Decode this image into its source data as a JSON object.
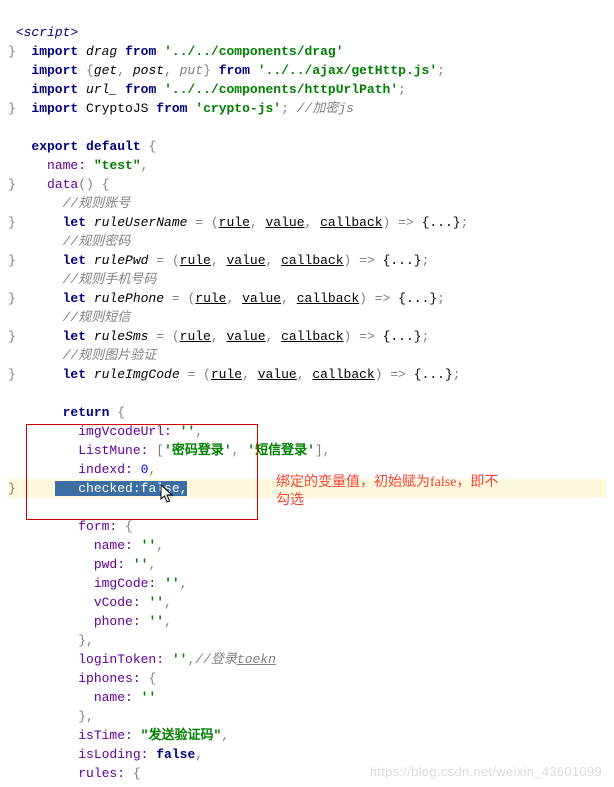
{
  "code": {
    "script_open": "<script>",
    "imp": "import",
    "from": "from",
    "drag_id": "drag",
    "drag_path": "'../../components/drag'",
    "get": "get",
    "post": "post",
    "put": "put",
    "ajax_path": "'../../ajax/getHttp.js'",
    "url_id": "url_",
    "url_path": "'../../components/httpUrlPath'",
    "crypto_id": "CryptoJS",
    "crypto_path": "'crypto-js'",
    "comment_crypto": "//加密js",
    "export": "export",
    "default": "default",
    "name_key": "name:",
    "name_val": "\"test\"",
    "data_key": "data",
    "c_account": "//规则账号",
    "let": "let",
    "ruleUserName": "ruleUserName",
    "rule": "rule",
    "value": "value",
    "callback": "callback",
    "arrow": "=>",
    "braces": "{...}",
    "c_pwd": "//规则密码",
    "rulePwd": "rulePwd",
    "c_phone": "//规则手机号码",
    "rulePhone": "rulePhone",
    "c_sms": "//规则短信",
    "ruleSms": "ruleSms",
    "c_img": "//规则图片验证",
    "ruleImgCode": "ruleImgCode",
    "return": "return",
    "imgVcodeUrl": "imgVcodeUrl:",
    "empty_str": "''",
    "ListMune": "ListMune:",
    "pwd_login": "'密码登录'",
    "sms_login": "'短信登录'",
    "indexd": "indexd:",
    "zero": "0",
    "checked": "checked:",
    "false": "false",
    "form": "form:",
    "formname": "name:",
    "pwd": "pwd:",
    "imgCode": "imgCode:",
    "vCode": "vCode:",
    "phone": "phone:",
    "loginToken": "loginToken:",
    "c_login": "//登录",
    "toekn": "toekn",
    "iphones": "iphones:",
    "isTime": "isTime:",
    "send_code": "\"发送验证码\"",
    "isLoding": "isLoding:",
    "rules": "rules:"
  },
  "annotation": {
    "line1": "绑定的变量值，初始赋为false，即不",
    "line2": "勾选"
  },
  "watermark": "https://blog.csdn.net/weixin_43601099"
}
